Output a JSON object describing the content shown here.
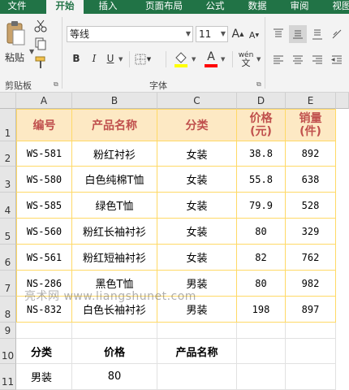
{
  "tabs": [
    {
      "label": "文件",
      "active": false
    },
    {
      "label": "开始",
      "active": true
    },
    {
      "label": "插入",
      "active": false
    },
    {
      "label": "页面布局",
      "active": false
    },
    {
      "label": "公式",
      "active": false
    },
    {
      "label": "数据",
      "active": false
    },
    {
      "label": "审阅",
      "active": false
    },
    {
      "label": "视图",
      "active": false
    }
  ],
  "ribbon": {
    "paste_label": "粘贴",
    "clipboard_label": "剪贴板",
    "font_group_label": "字体",
    "font_name": "等线",
    "font_size": "11",
    "bold": "B",
    "italic": "I",
    "underline": "U",
    "grow_font": "A",
    "shrink_font": "A",
    "font_color_letter": "A",
    "phonetic": "wén"
  },
  "columns": [
    "A",
    "B",
    "C",
    "D",
    "E"
  ],
  "rows": [
    "1",
    "2",
    "3",
    "4",
    "5",
    "6",
    "7",
    "8",
    "9",
    "10",
    "11"
  ],
  "table": {
    "headers": [
      "编号",
      "产品名称",
      "分类",
      "价格(元)",
      "销量(件)"
    ],
    "header_price_l1": "价格",
    "header_price_l2": "(元)",
    "header_qty_l1": "销量",
    "header_qty_l2": "(件)",
    "rows": [
      [
        "WS-581",
        "粉红衬衫",
        "女装",
        "38.8",
        "892"
      ],
      [
        "WS-580",
        "白色纯棉T恤",
        "女装",
        "55.8",
        "638"
      ],
      [
        "WS-585",
        "绿色T恤",
        "女装",
        "79.9",
        "528"
      ],
      [
        "WS-560",
        "粉红长袖衬衫",
        "女装",
        "80",
        "329"
      ],
      [
        "WS-561",
        "粉红短袖衬衫",
        "女装",
        "82",
        "762"
      ],
      [
        "NS-286",
        "黑色T恤",
        "男装",
        "80",
        "982"
      ],
      [
        "NS-832",
        "白色长袖衬衫",
        "男装",
        "198",
        "897"
      ]
    ]
  },
  "criteria": {
    "headers": [
      "分类",
      "价格",
      "产品名称"
    ],
    "values": [
      "男装",
      "80",
      ""
    ]
  },
  "watermark": "亮术网 www.liangshunet.com",
  "colors": {
    "ribbon_green": "#217346",
    "header_fill": "#fde9c4",
    "header_text": "#c0504d",
    "table_border": "#ffd966",
    "font_color_bar": "#ff0000",
    "highlight_bar": "#ffff00"
  }
}
